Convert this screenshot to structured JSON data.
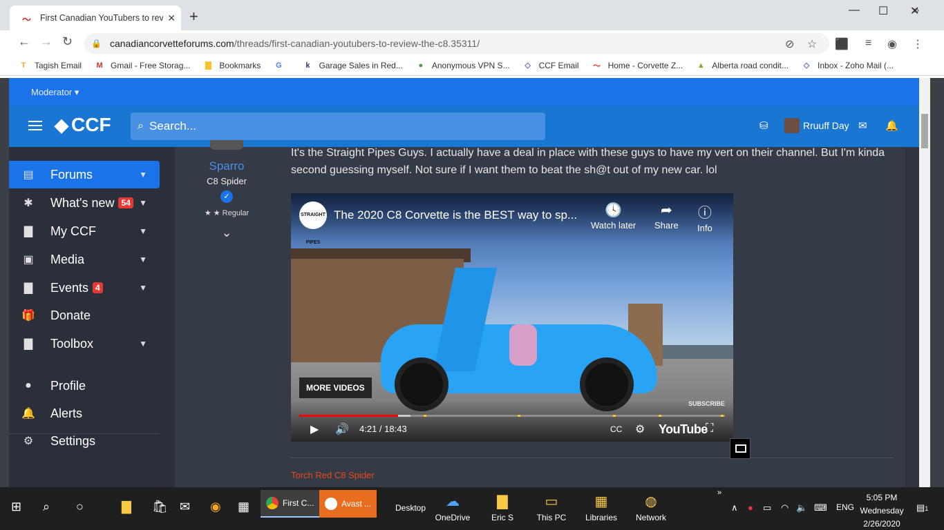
{
  "browser": {
    "tab_title": "First Canadian YouTubers to revie",
    "url_domain": "canadiancorvetteforums.com",
    "url_path": "/threads/first-canadian-youtubers-to-review-the-c8.35311/",
    "bookmarks": [
      {
        "label": "Tagish Email",
        "icon": "tagish-icon",
        "color": "#f9a825"
      },
      {
        "label": "Gmail - Free Storag...",
        "icon": "gmail-icon",
        "color": "#d93025"
      },
      {
        "label": "Bookmarks",
        "icon": "folder-icon",
        "color": "#fbc02d"
      },
      {
        "label": "",
        "icon": "google-icon",
        "color": "#4285f4"
      },
      {
        "label": "Garage Sales in Red...",
        "icon": "kijiji-icon",
        "color": "#373373"
      },
      {
        "label": "Anonymous VPN S...",
        "icon": "vpn-icon",
        "color": "#43a047"
      },
      {
        "label": "CCF Email",
        "icon": "mail-icon",
        "color": "#5c6bc0"
      },
      {
        "label": "Home - Corvette Z...",
        "icon": "corvette-icon",
        "color": "#e53935"
      },
      {
        "label": "Alberta road condit...",
        "icon": "alberta-icon",
        "color": "#9e9d24"
      },
      {
        "label": "Inbox - Zoho Mail (...",
        "icon": "mail-icon",
        "color": "#5c6bc0"
      }
    ]
  },
  "site": {
    "moderator_label": "Moderator",
    "logo_text": "CCF",
    "search_placeholder": "Search...",
    "user_name": "Rruuff Day",
    "sidebar": [
      {
        "label": "Forums",
        "icon": "forums-icon",
        "badge": "",
        "chevron": true,
        "active": true
      },
      {
        "label": "What's new",
        "icon": "whats-new-icon",
        "badge": "54",
        "chevron": true,
        "active": false
      },
      {
        "label": "My CCF",
        "icon": "folder-icon",
        "badge": "",
        "chevron": true,
        "active": false
      },
      {
        "label": "Media",
        "icon": "media-icon",
        "badge": "",
        "chevron": true,
        "active": false
      },
      {
        "label": "Events",
        "icon": "folder-icon",
        "badge": "4",
        "chevron": true,
        "active": false
      },
      {
        "label": "Donate",
        "icon": "gift-icon",
        "badge": "",
        "chevron": false,
        "active": false
      },
      {
        "label": "Toolbox",
        "icon": "folder-icon",
        "badge": "",
        "chevron": true,
        "active": false
      },
      {
        "label": "Profile",
        "icon": "person-icon",
        "badge": "",
        "chevron": false,
        "active": false
      },
      {
        "label": "Alerts",
        "icon": "bell-icon",
        "badge": "",
        "chevron": false,
        "active": false
      },
      {
        "label": "Settings",
        "icon": "gear-icon",
        "badge": "",
        "chevron": false,
        "active": false
      }
    ],
    "post": {
      "author_name": "Sparro",
      "author_title": "C8 Spider",
      "author_rank": "★ ★ Regular",
      "text": "It's the Straight Pipes Guys. I actually have a deal in place with these guys to have my vert on their channel. But I'm kinda second guessing myself. Not sure if I want them to beat the sh@t out of my new car. lol",
      "signature": "Torch Red C8 Spider"
    },
    "video": {
      "channel_badge": "STRAIGHT PIPES",
      "title": "The 2020 C8 Corvette is the BEST way to sp...",
      "watch_later": "Watch later",
      "share": "Share",
      "info": "Info",
      "more_videos": "MORE VIDEOS",
      "subscribe": "SUBSCRIBE",
      "time": "4:21 / 18:43",
      "played_fraction": 0.232,
      "buffered_fraction": 0.262,
      "youtube_label": "YouTube"
    }
  },
  "taskbar": {
    "apps": [
      {
        "label": "First C...",
        "active": true
      },
      {
        "label": "Avast ...",
        "active": false
      }
    ],
    "desktop_label": "Desktop",
    "toolbar_items": [
      {
        "label": "OneDrive",
        "icon": "onedrive-icon"
      },
      {
        "label": "Eric S",
        "icon": "user-folder-icon"
      },
      {
        "label": "This PC",
        "icon": "this-pc-icon"
      },
      {
        "label": "Libraries",
        "icon": "libraries-icon"
      },
      {
        "label": "Network",
        "icon": "network-icon"
      }
    ],
    "language": "ENG",
    "time": "5:05 PM",
    "day": "Wednesday",
    "date": "2/26/2020",
    "notification_count": "1"
  }
}
